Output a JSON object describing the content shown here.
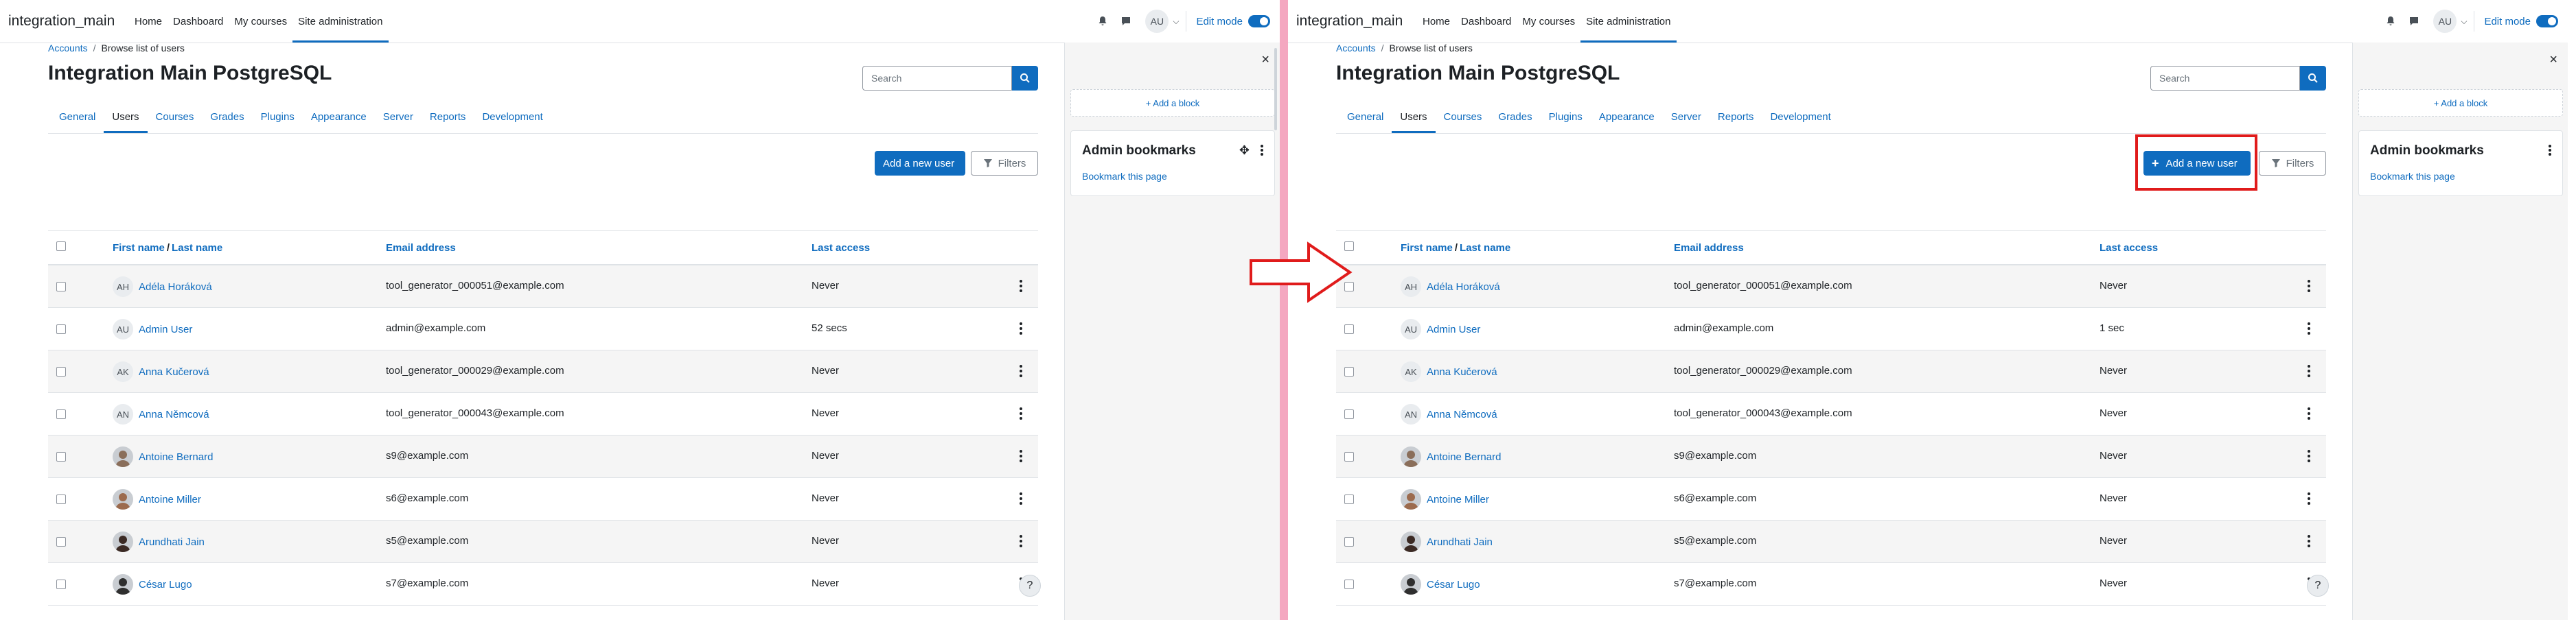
{
  "site_name": "integration_main",
  "nav": {
    "items": [
      "Home",
      "Dashboard",
      "My courses",
      "Site administration"
    ],
    "active_index": 3,
    "user_initials": "AU",
    "edit_mode_label": "Edit mode"
  },
  "breadcrumb": {
    "parent": "Accounts",
    "current": "Browse list of users"
  },
  "page_title": "Integration Main PostgreSQL",
  "search": {
    "placeholder": "Search"
  },
  "tabs": [
    "General",
    "Users",
    "Courses",
    "Grades",
    "Plugins",
    "Appearance",
    "Server",
    "Reports",
    "Development"
  ],
  "active_tab": "Users",
  "buttons": {
    "add_user": "Add a new user",
    "add_user_plus": "+",
    "filters": "Filters"
  },
  "table": {
    "first_name": "First name",
    "slash": "/",
    "last_name": "Last name",
    "email": "Email address",
    "last_access": "Last access"
  },
  "users_left": [
    {
      "avatar": "initials",
      "initials": "AH",
      "name": "Adéla Horáková",
      "email": "tool_generator_000051@example.com",
      "last_access": "Never"
    },
    {
      "avatar": "initials",
      "initials": "AU",
      "name": "Admin User",
      "email": "admin@example.com",
      "last_access": "52 secs"
    },
    {
      "avatar": "initials",
      "initials": "AK",
      "name": "Anna Kučerová",
      "email": "tool_generator_000029@example.com",
      "last_access": "Never"
    },
    {
      "avatar": "initials",
      "initials": "AN",
      "name": "Anna Němcová",
      "email": "tool_generator_000043@example.com",
      "last_access": "Never"
    },
    {
      "avatar": "photo",
      "photo_color": "#8a6e5a",
      "name": "Antoine Bernard",
      "email": "s9@example.com",
      "last_access": "Never"
    },
    {
      "avatar": "photo",
      "photo_color": "#9c6b4e",
      "name": "Antoine Miller",
      "email": "s6@example.com",
      "last_access": "Never"
    },
    {
      "avatar": "photo",
      "photo_color": "#3b2a24",
      "name": "Arundhati Jain",
      "email": "s5@example.com",
      "last_access": "Never"
    },
    {
      "avatar": "photo",
      "photo_color": "#2f2f2f",
      "name": "César Lugo",
      "email": "s7@example.com",
      "last_access": "Never"
    }
  ],
  "users_right": [
    {
      "avatar": "initials",
      "initials": "AH",
      "name": "Adéla Horáková",
      "email": "tool_generator_000051@example.com",
      "last_access": "Never"
    },
    {
      "avatar": "initials",
      "initials": "AU",
      "name": "Admin User",
      "email": "admin@example.com",
      "last_access": "1 sec"
    },
    {
      "avatar": "initials",
      "initials": "AK",
      "name": "Anna Kučerová",
      "email": "tool_generator_000029@example.com",
      "last_access": "Never"
    },
    {
      "avatar": "initials",
      "initials": "AN",
      "name": "Anna Němcová",
      "email": "tool_generator_000043@example.com",
      "last_access": "Never"
    },
    {
      "avatar": "photo",
      "photo_color": "#8a6e5a",
      "name": "Antoine Bernard",
      "email": "s9@example.com",
      "last_access": "Never"
    },
    {
      "avatar": "photo",
      "photo_color": "#9c6b4e",
      "name": "Antoine Miller",
      "email": "s6@example.com",
      "last_access": "Never"
    },
    {
      "avatar": "photo",
      "photo_color": "#3b2a24",
      "name": "Arundhati Jain",
      "email": "s5@example.com",
      "last_access": "Never"
    },
    {
      "avatar": "photo",
      "photo_color": "#2f2f2f",
      "name": "César Lugo",
      "email": "s7@example.com",
      "last_access": "Never"
    }
  ],
  "drawer": {
    "add_block": "+ Add a block",
    "block_title": "Admin bookmarks",
    "block_link": "Bookmark this page",
    "close": "×"
  },
  "help_label": "?",
  "colors": {
    "accent": "#0f6cbf",
    "highlight": "#e01b1b",
    "divider": "#f4a7c0"
  }
}
